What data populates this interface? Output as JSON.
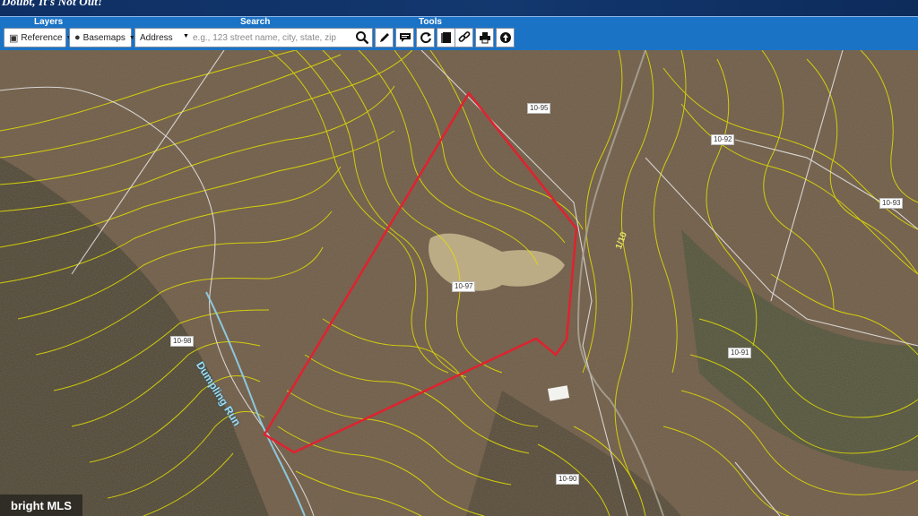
{
  "banner": {
    "tagline": "Doubt, It's Not Out!"
  },
  "toolbar": {
    "layers_title": "Layers",
    "search_title": "Search",
    "tools_title": "Tools",
    "reference_label": "Reference",
    "basemaps_label": "Basemaps",
    "search_type": "Address",
    "search_placeholder": "e.g., 123 street name, city, state, zip",
    "tools": [
      "pencil-icon",
      "comment-icon",
      "refresh-icon",
      "document-icon",
      "link-icon",
      "print-icon",
      "upload-icon"
    ]
  },
  "map": {
    "parcel_labels": [
      "10-95",
      "10-92",
      "10-93",
      "10-97",
      "10-98",
      "10-91",
      "10-90"
    ],
    "stream_name": "Dumpling Run",
    "road_label": "1/10",
    "boundary_color": "#e0222f",
    "contour_color": "#e3e000"
  },
  "watermark": {
    "text": "bright MLS"
  }
}
